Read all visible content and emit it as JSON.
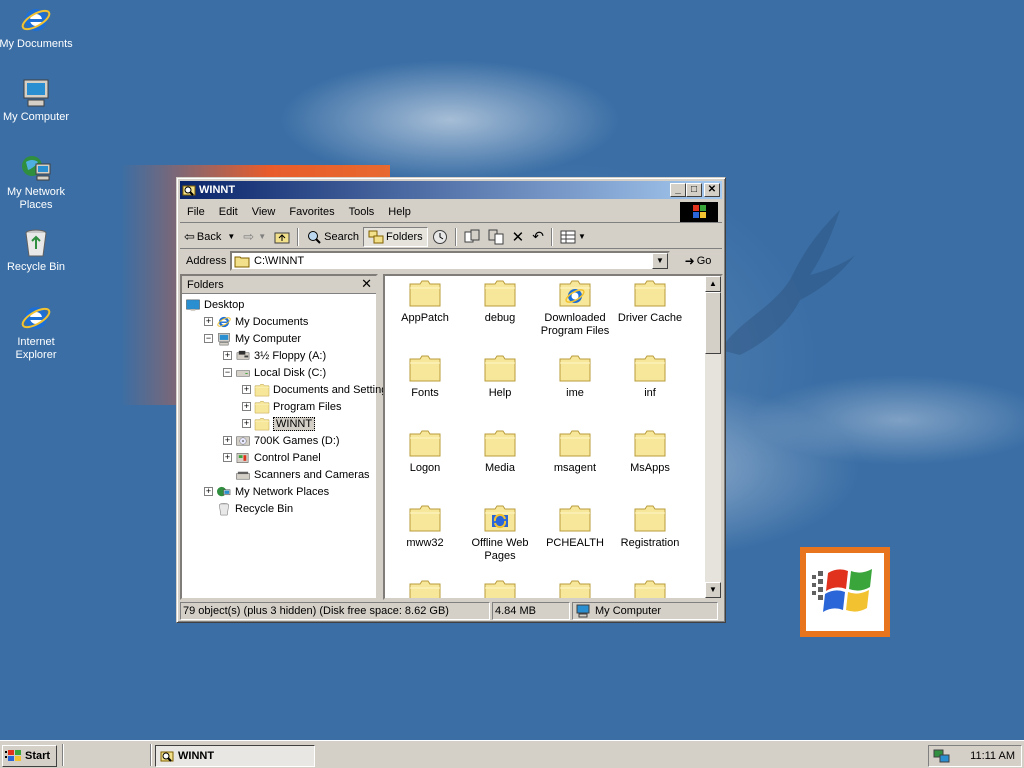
{
  "desktop": {
    "icons": [
      {
        "label": "My Documents",
        "icon": "ie-icon"
      },
      {
        "label": "My Computer",
        "icon": "computer-icon"
      },
      {
        "label": "My Network Places",
        "icon": "network-icon"
      },
      {
        "label": "Recycle Bin",
        "icon": "recycle-bin-icon"
      },
      {
        "label": "Internet Explorer",
        "icon": "ie-icon"
      }
    ]
  },
  "window": {
    "title": "WINNT",
    "controls": [
      "_",
      "□",
      "✕"
    ],
    "menu": [
      "File",
      "Edit",
      "View",
      "Favorites",
      "Tools",
      "Help"
    ],
    "toolbar": {
      "back": "Back",
      "search": "Search",
      "folders": "Folders"
    },
    "address": {
      "label": "Address",
      "value": "C:\\WINNT",
      "go": "Go"
    },
    "folders_pane": {
      "title": "Folders",
      "close": "✕",
      "tree": [
        {
          "label": "Desktop",
          "expander": "",
          "icon": "desktop-icon"
        },
        {
          "label": "My Documents",
          "expander": "+",
          "icon": "ie-icon"
        },
        {
          "label": "My Computer",
          "expander": "−",
          "icon": "computer-icon"
        },
        {
          "label": "3½ Floppy (A:)",
          "expander": "+",
          "icon": "floppy-icon"
        },
        {
          "label": "Local Disk (C:)",
          "expander": "−",
          "icon": "drive-icon"
        },
        {
          "label": "Documents and Settings",
          "expander": "+",
          "icon": "folder-icon"
        },
        {
          "label": "Program Files",
          "expander": "+",
          "icon": "folder-icon"
        },
        {
          "label": "WINNT",
          "expander": "+",
          "icon": "folder-open-icon",
          "selected": true
        },
        {
          "label": "700K Games (D:)",
          "expander": "+",
          "icon": "cd-icon"
        },
        {
          "label": "Control Panel",
          "expander": "+",
          "icon": "control-panel-icon"
        },
        {
          "label": "Scanners and Cameras",
          "expander": "",
          "icon": "scanner-icon"
        },
        {
          "label": "My Network Places",
          "expander": "+",
          "icon": "network-icon"
        },
        {
          "label": "Recycle Bin",
          "expander": "",
          "icon": "recycle-bin-icon"
        }
      ]
    },
    "files": [
      {
        "label": "AppPatch",
        "icon": "folder-icon"
      },
      {
        "label": "debug",
        "icon": "folder-icon"
      },
      {
        "label": "Downloaded Program Files",
        "icon": "ie-folder-icon"
      },
      {
        "label": "Driver Cache",
        "icon": "folder-icon"
      },
      {
        "label": "Fonts",
        "icon": "folder-icon"
      },
      {
        "label": "Help",
        "icon": "folder-icon"
      },
      {
        "label": "ime",
        "icon": "folder-icon"
      },
      {
        "label": "inf",
        "icon": "folder-icon"
      },
      {
        "label": "Logon",
        "icon": "folder-icon"
      },
      {
        "label": "Media",
        "icon": "folder-icon"
      },
      {
        "label": "msagent",
        "icon": "folder-icon"
      },
      {
        "label": "MsApps",
        "icon": "folder-icon"
      },
      {
        "label": "mww32",
        "icon": "folder-icon"
      },
      {
        "label": "Offline Web Pages",
        "icon": "sync-folder-icon"
      },
      {
        "label": "PCHEALTH",
        "icon": "folder-icon"
      },
      {
        "label": "Registration",
        "icon": "folder-icon"
      },
      {
        "label": "",
        "icon": "folder-icon"
      },
      {
        "label": "",
        "icon": "folder-icon"
      },
      {
        "label": "",
        "icon": "folder-icon"
      },
      {
        "label": "",
        "icon": "folder-icon"
      }
    ],
    "status": {
      "objects": "79 object(s) (plus 3 hidden) (Disk free space: 8.62 GB)",
      "size": "4.84 MB",
      "zone": "My Computer"
    }
  },
  "taskbar": {
    "start": "Start",
    "task": "WINNT",
    "clock": "11:11 AM"
  }
}
